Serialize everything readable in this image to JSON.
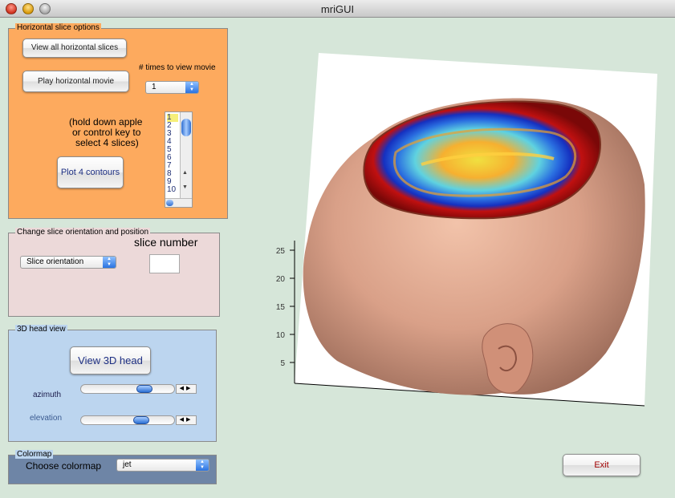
{
  "window": {
    "title": "mriGUI"
  },
  "horizontal_panel": {
    "legend": "Horizontal slice options",
    "view_all_button": "View all horizontal slices",
    "play_movie_button": "Play horizontal movie",
    "times_label": "# times to view movie",
    "times_popup_value": "1",
    "instructions_line1": "(hold down apple",
    "instructions_line2": "or control key to",
    "instructions_line3": "select 4 slices)",
    "plot_contours_button": "Plot 4 contours",
    "slice_list": [
      "1",
      "2",
      "3",
      "4",
      "5",
      "6",
      "7",
      "8",
      "9",
      "10"
    ],
    "selected_slice": "1"
  },
  "orientation_panel": {
    "legend": "Change slice orientation and position",
    "slice_number_label": "slice number",
    "orientation_popup_value": "Slice orientation",
    "slice_number_value": ""
  },
  "head_panel": {
    "legend": "3D head view",
    "view_button": "View 3D head",
    "azimuth_label": "azimuth",
    "elevation_label": "elevation",
    "azimuth_value": 0.72,
    "elevation_value": 0.68
  },
  "colormap_panel": {
    "legend": "Colormap",
    "label": "Choose colormap",
    "popup_value": "jet"
  },
  "exit_button": "Exit",
  "axes": {
    "zticks": [
      "25",
      "20",
      "15",
      "10",
      "5"
    ]
  },
  "colors": {
    "window_bg": "#d6e6d9",
    "horizontal_panel": "#fdaa5e",
    "orientation_panel": "#ecd9d9",
    "head_panel": "#bcd5ef",
    "colormap_panel": "#6e85a6",
    "skin": "#d9a088"
  },
  "icons": {
    "popup_arrows": "up-down-arrows-icon",
    "slider_arrows": "left-right-arrows-icon"
  }
}
